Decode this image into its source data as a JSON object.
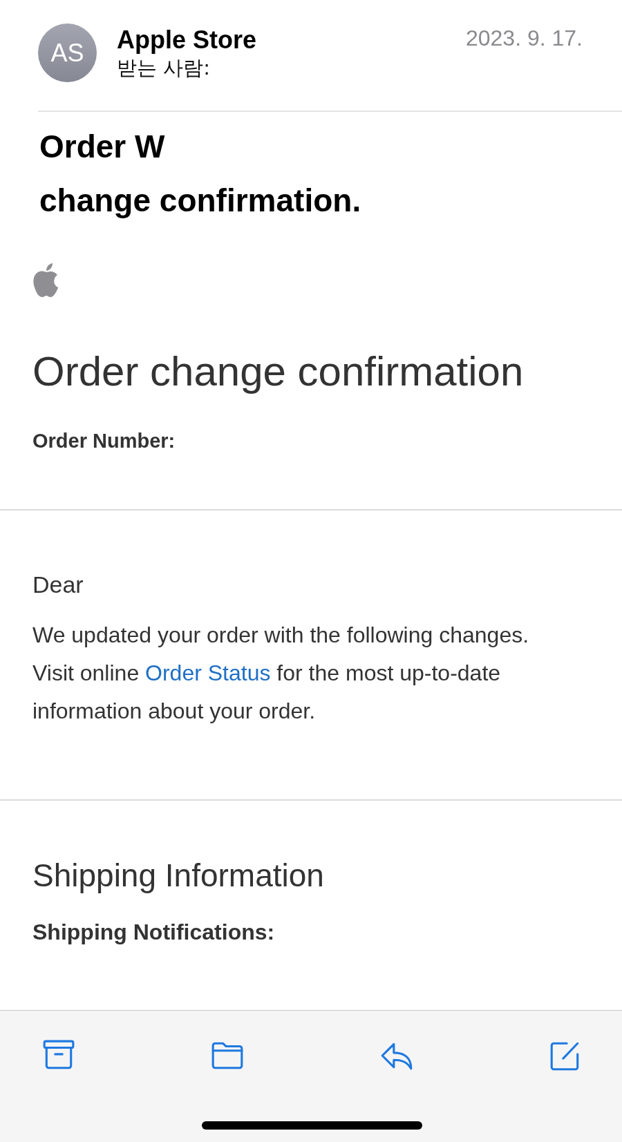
{
  "header": {
    "avatar_initials": "AS",
    "sender": "Apple Store",
    "recipient_label": "받는 사람:",
    "date": "2023. 9. 17."
  },
  "subject_lines": [
    "Order W",
    "change confirmation."
  ],
  "body": {
    "heading": "Order change confirmation",
    "order_number_label": "Order Number:",
    "greeting": "Dear",
    "paragraph": [
      {
        "kind": "text",
        "text": "We updated your order with the following changes. Visit online "
      },
      {
        "kind": "link",
        "text": "Order Status"
      },
      {
        "kind": "text",
        "text": " for the most up-to-date information about your order."
      }
    ],
    "section_heading": "Shipping Information",
    "section_subheading": "Shipping Notifications:"
  },
  "toolbar": [
    {
      "kind": "archive"
    },
    {
      "kind": "folder"
    },
    {
      "kind": "reply"
    },
    {
      "kind": "compose"
    }
  ]
}
